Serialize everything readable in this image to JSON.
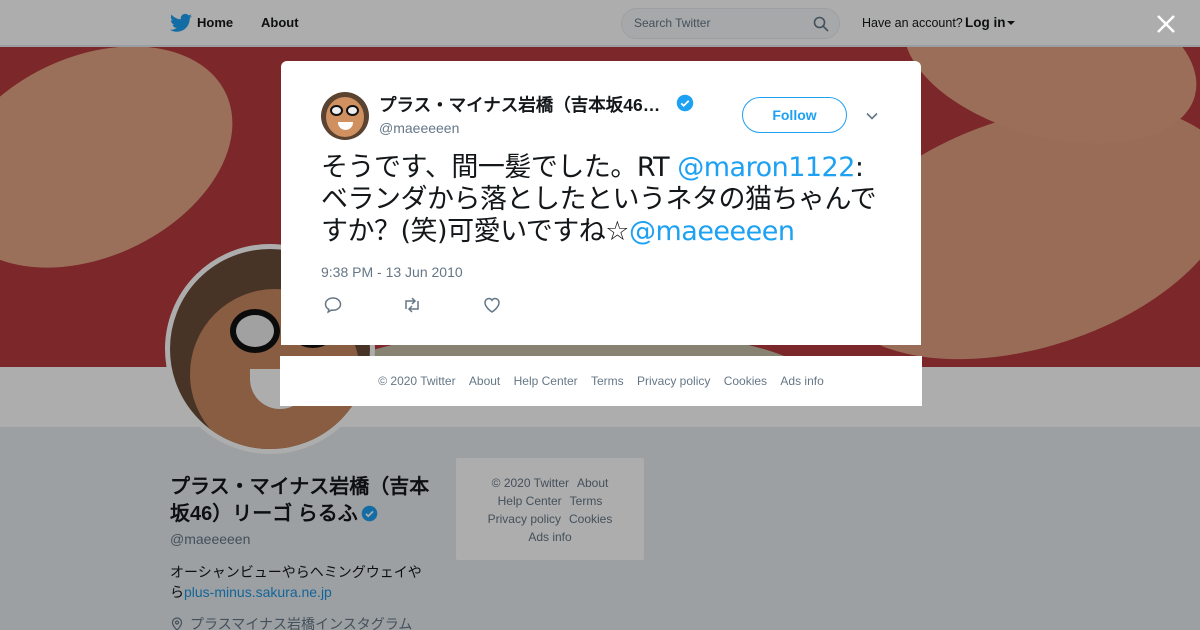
{
  "topnav": {
    "home_label": "Home",
    "about_label": "About",
    "search_placeholder": "Search Twitter",
    "have_account": "Have an account?",
    "login_label": "Log in"
  },
  "profile": {
    "name": "プラス・マイナス岩橋（吉本坂46）リーゴ らるふ",
    "handle": "@maeeeeen",
    "bio_text": "オーシャンビューやらヘミングウェイやら",
    "bio_link": "plus-minus.sakura.ne.jp",
    "location": "プラスマイナス岩橋インスタグラム"
  },
  "side_footer": {
    "items": [
      "© 2020 Twitter",
      "About",
      "Help Center",
      "Terms",
      "Privacy policy",
      "Cookies",
      "Ads info"
    ]
  },
  "tweet": {
    "display_name": "プラス・マイナス岩橋（吉本坂46…",
    "handle": "@maeeeeen",
    "follow_label": "Follow",
    "text_1": "そうです、間一髪でした。RT ",
    "mention_1": "@maron1122",
    "text_2": ": ベランダから落としたというネタの猫ちゃんですか？(笑)可愛いですね☆",
    "mention_2": "@maeeeeen",
    "timestamp": "9:38 PM - 13 Jun 2010"
  },
  "modal_footer": {
    "items": [
      "© 2020 Twitter",
      "About",
      "Help Center",
      "Terms",
      "Privacy policy",
      "Cookies",
      "Ads info"
    ]
  },
  "colors": {
    "accent": "#1da1f2",
    "banner": "#b73a3d"
  },
  "icons": [
    "twitter-bird-icon",
    "search-icon",
    "close-icon",
    "verified-icon",
    "chevron-down-icon",
    "reply-icon",
    "retweet-icon",
    "like-icon",
    "location-icon"
  ]
}
